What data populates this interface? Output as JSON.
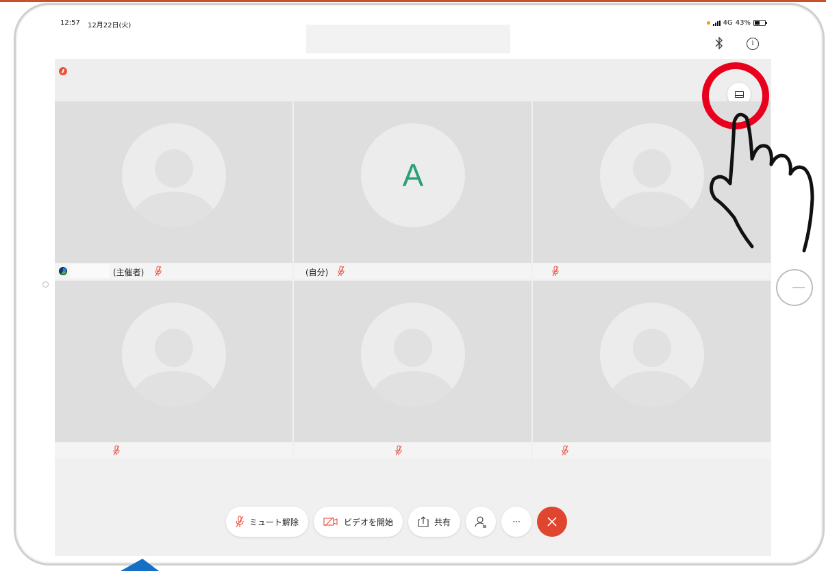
{
  "status_bar": {
    "time": "12:57",
    "date": "12月22日(火)",
    "network": "4G",
    "battery": "43%"
  },
  "participants": [
    {
      "letter": "",
      "role": "(主催者)",
      "host": true
    },
    {
      "letter": "A",
      "role": "(自分)",
      "host": false
    },
    {
      "letter": "",
      "role": "",
      "host": false
    },
    {
      "letter": "",
      "role": "",
      "host": false
    },
    {
      "letter": "",
      "role": "",
      "host": false
    },
    {
      "letter": "",
      "role": "",
      "host": false
    }
  ],
  "toolbar": {
    "unmute_label": "ミュート解除",
    "start_video_label": "ビデオを開始",
    "share_label": "共有",
    "more_label": "···"
  },
  "colors": {
    "mute_red": "#e84a3b",
    "end_call": "#e0452f",
    "avatar_letter": "#2aa07a",
    "annotation_circle": "#e8001c",
    "annotation_arrow": "#1570c4"
  },
  "icons": [
    "bluetooth-icon",
    "info-icon",
    "layout-icon",
    "mic-off-icon",
    "video-off-icon",
    "share-icon",
    "participants-icon",
    "end-call-icon"
  ]
}
